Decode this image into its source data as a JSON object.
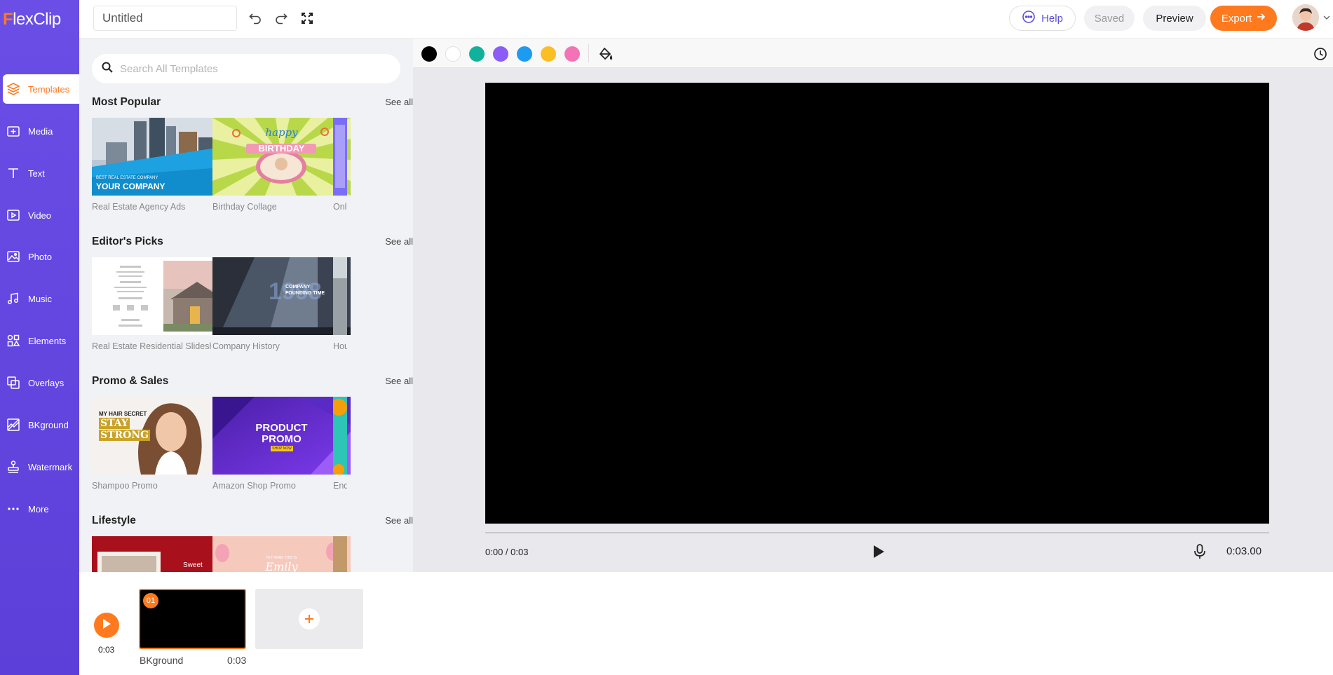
{
  "app": {
    "logo_first": "F",
    "logo_rest": "lexClip",
    "brand_color": "#ff7a1f",
    "sidebar_color": "#6a4ee6"
  },
  "sidebar": {
    "items": [
      {
        "label": "Templates",
        "icon": "layers-icon"
      },
      {
        "label": "Media",
        "icon": "media-plus-icon"
      },
      {
        "label": "Text",
        "icon": "text-t-icon"
      },
      {
        "label": "Video",
        "icon": "video-play-icon"
      },
      {
        "label": "Photo",
        "icon": "image-icon"
      },
      {
        "label": "Music",
        "icon": "music-note-icon"
      },
      {
        "label": "Elements",
        "icon": "shapes-icon"
      },
      {
        "label": "Overlays",
        "icon": "overlays-icon"
      },
      {
        "label": "BKground",
        "icon": "background-icon"
      },
      {
        "label": "Watermark",
        "icon": "stamp-icon"
      },
      {
        "label": "More",
        "icon": "more-dots-icon"
      }
    ]
  },
  "topbar": {
    "project_title": "Untitled",
    "help_label": "Help",
    "saved_label": "Saved",
    "preview_label": "Preview",
    "export_label": "Export"
  },
  "templates_panel": {
    "search_placeholder": "Search All Templates",
    "see_all_label": "See all",
    "sections": [
      {
        "title": "Most Popular",
        "items": [
          "Real Estate Agency Ads",
          "Birthday Collage",
          "Onl"
        ]
      },
      {
        "title": "Editor's Picks",
        "items": [
          "Real Estate Residential Slideshow",
          "Company History",
          "Hou"
        ]
      },
      {
        "title": "Promo & Sales",
        "items": [
          "Shampoo Promo",
          "Amazon Shop Promo",
          "End"
        ]
      },
      {
        "title": "Lifestyle",
        "items": [
          "",
          "",
          ""
        ]
      }
    ],
    "thumb_text": {
      "realestate_small": "BEST REAL ESTATE COMPANY",
      "realestate_big": "YOUR COMPANY",
      "birthday_happy": "happy",
      "birthday_big": "BIRTHDAY",
      "company_history": "COMPANY FOUNDING TIME",
      "company_year": "1998",
      "shampoo_small": "MY HAIR SECRET",
      "shampoo_line1": "STAY",
      "shampoo_line2": "STRONG",
      "product_line1": "PRODUCT",
      "product_line2": "PROMO",
      "product_tag": "SHOP NOW",
      "lifestyle_sweet": "Sweet",
      "lifestyle_emily": "Emily",
      "lifestyle_hi": "HI THERE! THIS IS"
    }
  },
  "stage": {
    "swatches": [
      "#000000",
      "#ffffff",
      "#11b29b",
      "#8b5cf6",
      "#1d9bf0",
      "#fbbf24",
      "#f472b6"
    ],
    "time_readout": "0:00 / 0:03",
    "duration": "0:03.00"
  },
  "timeline": {
    "total_time": "0:03",
    "scenes": [
      {
        "number": "01",
        "name": "BKground",
        "duration": "0:03"
      }
    ]
  }
}
